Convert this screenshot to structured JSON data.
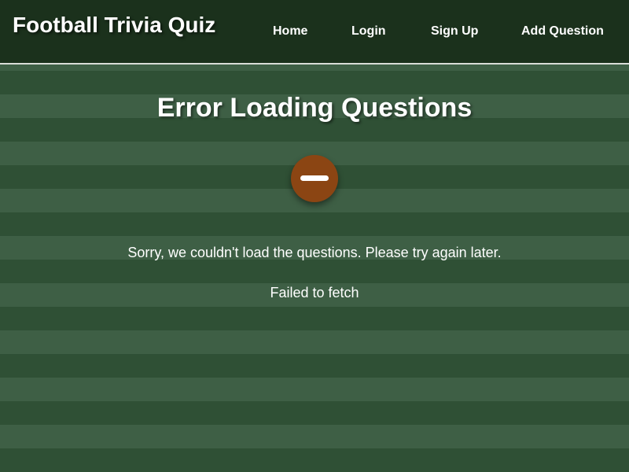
{
  "navbar": {
    "brand": "Football Trivia Quiz",
    "links": [
      {
        "label": "Home"
      },
      {
        "label": "Login"
      },
      {
        "label": "Sign Up"
      },
      {
        "label": "Add Question"
      }
    ]
  },
  "error": {
    "title": "Error Loading Questions",
    "icon": "football-icon",
    "message": "Sorry, we couldn't load the questions. Please try again later.",
    "detail": "Failed to fetch"
  },
  "colors": {
    "navbar_bg": "#1b311c",
    "stripe_light": "#3e5f45",
    "stripe_dark": "#2f5035",
    "icon_bg": "#8b4513",
    "text": "#ffffff"
  }
}
